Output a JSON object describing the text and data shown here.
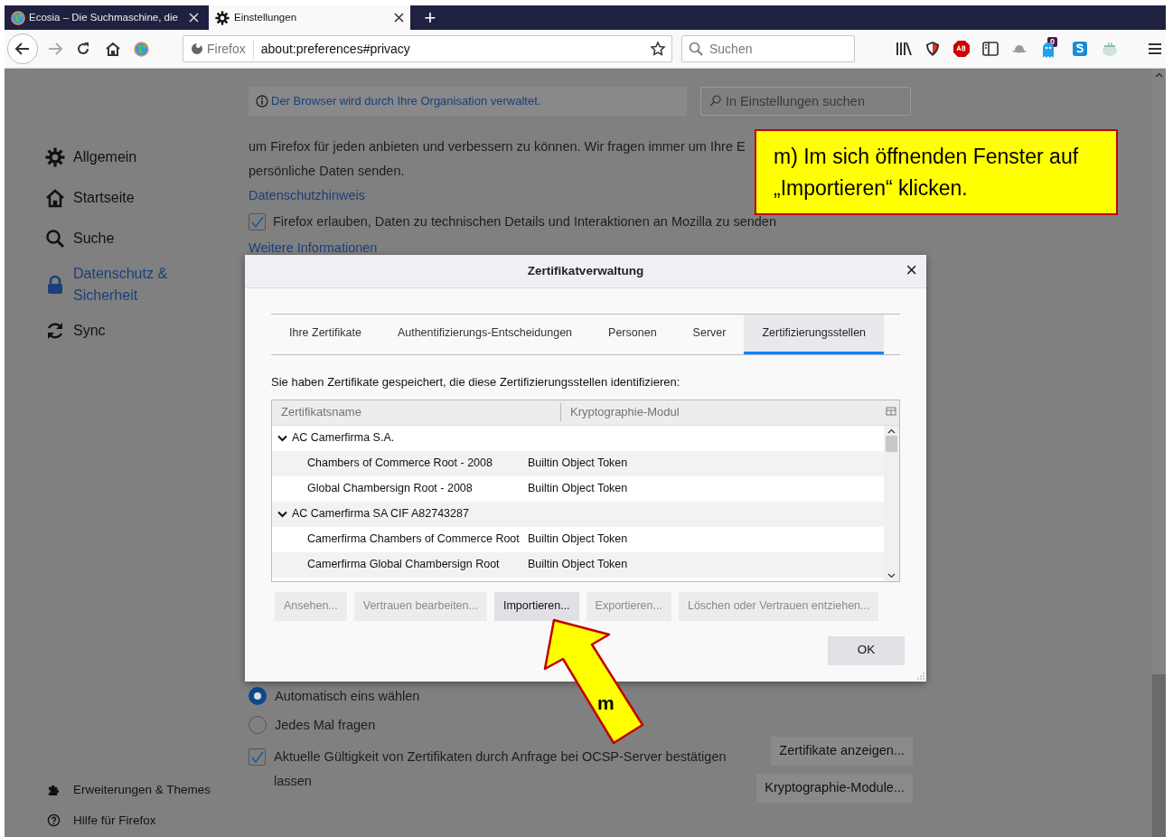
{
  "browser_tabs": [
    {
      "title": "Ecosia – Die Suchmaschine, die",
      "kind": "globe",
      "selected": false
    },
    {
      "title": "Einstellungen",
      "kind": "gear",
      "selected": true
    }
  ],
  "new_tab": "+",
  "address_bar": {
    "identity": "Firefox",
    "url": "about:preferences#privacy"
  },
  "search_field": {
    "placeholder": "Suchen"
  },
  "extension_badge": "0",
  "sidebar": {
    "items": [
      {
        "label": "Allgemein",
        "kind": "gear",
        "selected": false
      },
      {
        "label": "Startseite",
        "kind": "home",
        "selected": false
      },
      {
        "label": "Suche",
        "kind": "search",
        "selected": false
      },
      {
        "label": "Datenschutz & Sicherheit",
        "kind": "lock",
        "selected": true
      },
      {
        "label": "Sync",
        "kind": "sync",
        "selected": false
      }
    ],
    "footer": [
      {
        "label": "Erweiterungen & Themes",
        "kind": "puzzle"
      },
      {
        "label": "Hilfe für Firefox",
        "kind": "help"
      }
    ]
  },
  "notice": "Der Browser wird durch Ihre Organisation verwaltet.",
  "settings_search": {
    "placeholder": "In Einstellungen suchen"
  },
  "privacy_text": [
    "um Firefox für jeden anbieten und verbessern zu können. Wir fragen immer um Ihre E",
    "persönliche Daten senden."
  ],
  "privacy_link": "Datenschutzhinweis",
  "telemetry": {
    "label": "Firefox erlauben, Daten zu technischen Details und Interaktionen an Mozilla zu senden",
    "checked": true
  },
  "more_info_link": "Weitere Informationen",
  "certificate_choice": [
    {
      "label": "Automatisch eins wählen",
      "selected": true
    },
    {
      "label": "Jedes Mal fragen",
      "selected": false
    }
  ],
  "ocsp": {
    "label": "Aktuelle Gültigkeit von Zertifikaten durch Anfrage bei OCSP-Server bestätigen lassen",
    "checked": true
  },
  "certificate_buttons": [
    "Zertifikate anzeigen...",
    "Kryptographie-Module..."
  ],
  "dialog": {
    "title": "Zertifikatverwaltung",
    "close": "×",
    "tabs": [
      {
        "label": "Ihre Zertifikate",
        "selected": false
      },
      {
        "label": "Authentifizierungs-Entscheidungen",
        "selected": false
      },
      {
        "label": "Personen",
        "selected": false
      },
      {
        "label": "Server",
        "selected": false
      },
      {
        "label": "Zertifizierungsstellen",
        "selected": true
      }
    ],
    "description": "Sie haben Zertifikate gespeichert, die diese Zertifizierungsstellen identifizieren:",
    "columns": [
      "Zertifikatsname",
      "Kryptographie-Modul"
    ],
    "tree": [
      {
        "name": "AC Camerfirma S.A.",
        "expanded": true,
        "children": [
          {
            "name": "Chambers of Commerce Root - 2008",
            "module": "Builtin Object Token"
          },
          {
            "name": "Global Chambersign Root - 2008",
            "module": "Builtin Object Token"
          }
        ]
      },
      {
        "name": "AC Camerfirma SA CIF A82743287",
        "expanded": true,
        "children": [
          {
            "name": "Camerfirma Chambers of Commerce Root",
            "module": "Builtin Object Token"
          },
          {
            "name": "Camerfirma Global Chambersign Root",
            "module": "Builtin Object Token"
          }
        ]
      }
    ],
    "buttons": [
      {
        "label": "Ansehen...",
        "disabled": true
      },
      {
        "label": "Vertrauen bearbeiten...",
        "disabled": true
      },
      {
        "label": "Importieren...",
        "disabled": false
      },
      {
        "label": "Exportieren...",
        "disabled": true
      },
      {
        "label": "Löschen oder Vertrauen entziehen...",
        "disabled": true
      }
    ],
    "ok": "OK"
  },
  "callout": "m) Im sich öffnenden Fenster auf „Importieren“ klicken.",
  "arrow_label": "m"
}
